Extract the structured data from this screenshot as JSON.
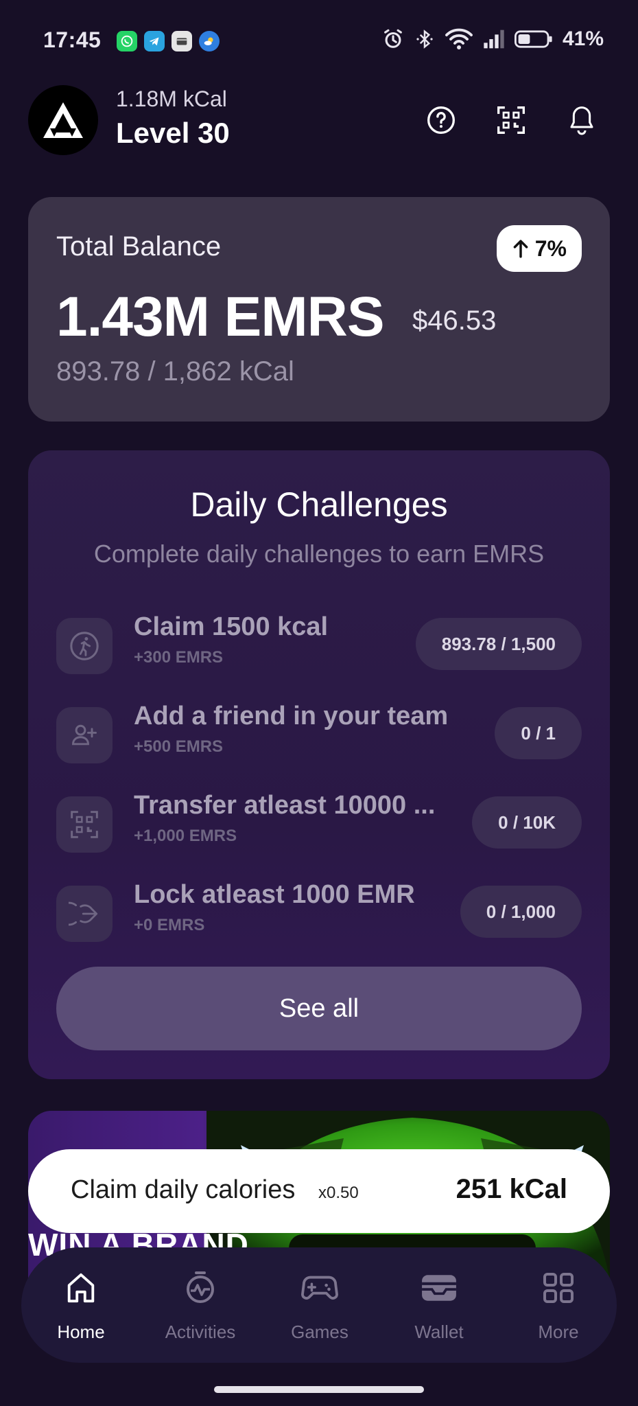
{
  "status_bar": {
    "time": "17:45",
    "battery_percent": "41%",
    "app_icons": [
      "whatsapp-icon",
      "telegram-icon",
      "wallet-app-icon",
      "weather-icon"
    ],
    "system_icons": [
      "alarm-icon",
      "bluetooth-icon",
      "wifi-icon",
      "signal-icon",
      "battery-icon"
    ]
  },
  "header": {
    "kcal": "1.18M kCal",
    "level": "Level 30",
    "icons": [
      "help-icon",
      "qr-scan-icon",
      "bell-icon"
    ]
  },
  "balance": {
    "label": "Total Balance",
    "change": "7%",
    "change_direction": "up",
    "amount": "1.43M EMRS",
    "usd": "$46.53",
    "kcal_progress": "893.78 / 1,862 kCal"
  },
  "challenges": {
    "title": "Daily Challenges",
    "subtitle": "Complete daily challenges to earn EMRS",
    "items": [
      {
        "name": "Claim 1500 kcal",
        "reward": "+300 EMRS",
        "progress": "893.78 / 1,500",
        "icon": "running-icon"
      },
      {
        "name": "Add a friend in your team",
        "reward": "+500 EMRS",
        "progress": "0 / 1",
        "icon": "add-user-icon"
      },
      {
        "name": "Transfer atleast 10000 ...",
        "reward": "+1,000 EMRS",
        "progress": "0 / 10K",
        "icon": "qr-transfer-icon"
      },
      {
        "name": "Lock atleast 1000 EMR",
        "reward": "+0 EMRS",
        "progress": "0 / 1,000",
        "icon": "lock-stake-icon"
      }
    ],
    "see_all": "See all"
  },
  "promo": {
    "text": "WIN A BRAND"
  },
  "claim": {
    "label": "Claim daily calories",
    "multiplier": "x0.50",
    "value": "251 kCal"
  },
  "nav": {
    "items": [
      {
        "label": "Home",
        "icon": "home-icon",
        "active": true
      },
      {
        "label": "Activities",
        "icon": "activity-stopwatch-icon",
        "active": false
      },
      {
        "label": "Games",
        "icon": "gamepad-icon",
        "active": false
      },
      {
        "label": "Wallet",
        "icon": "wallet-icon",
        "active": false
      },
      {
        "label": "More",
        "icon": "grid-more-icon",
        "active": false
      }
    ]
  },
  "colors": {
    "background": "#170f26",
    "card": "#3b3348",
    "challenge_card": "#2d1d48",
    "button": "#5b4d77",
    "nav": "#1f1838"
  }
}
